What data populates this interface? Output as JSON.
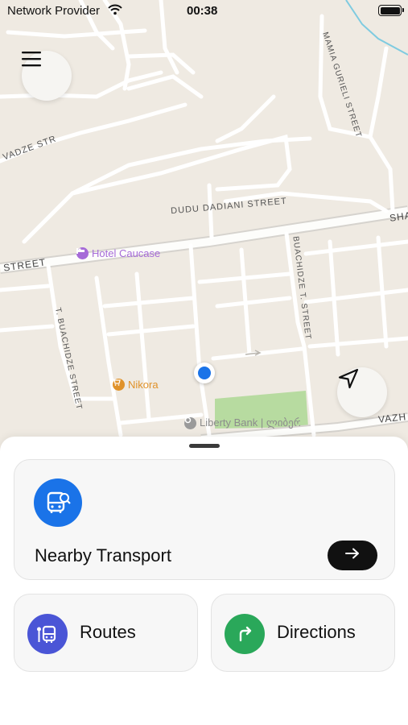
{
  "status_bar": {
    "carrier": "Network Provider",
    "time": "00:38",
    "battery_level": 1.0
  },
  "map": {
    "street_labels": {
      "vadze": "VADZE STR",
      "dudu_dadiani": "DUDU DADIANI STREET",
      "street_left": "STREET",
      "sha": "SHA",
      "mamia_gurieli": "MAMIA GURIELI STREET",
      "buachidze_t": "BUACHIDZE T. STREET",
      "t_buachidze": "T. BUACHIDZE STREET",
      "vazh": "VAZH"
    },
    "pois": {
      "hotel": {
        "name": "Hotel Caucase",
        "color": "#a66bd8",
        "icon": "bed-icon"
      },
      "nikora": {
        "name": "Nikora",
        "color": "#e0922a",
        "icon": "shopping-cart-icon"
      },
      "liberty": {
        "name": "Liberty Bank | ლიბერთი ბანკი",
        "color": "#8c8c8c",
        "icon": "bank-icon"
      }
    },
    "colors": {
      "background": "#efeae2",
      "park": "#b7dba0",
      "water": "#7fcbe0",
      "user_location": "#1a73e8"
    }
  },
  "controls": {
    "menu_icon": "hamburger-menu-icon",
    "locate_icon": "navigation-arrow-icon"
  },
  "sheet": {
    "nearby": {
      "label": "Nearby Transport",
      "icon": "bus-search-icon",
      "icon_color": "#1a73e8",
      "action_icon": "arrow-right-icon"
    },
    "routes": {
      "label": "Routes",
      "icon": "bus-route-icon",
      "icon_color": "#4a55d6"
    },
    "directions": {
      "label": "Directions",
      "icon": "turn-right-icon",
      "icon_color": "#2aa85a"
    }
  }
}
